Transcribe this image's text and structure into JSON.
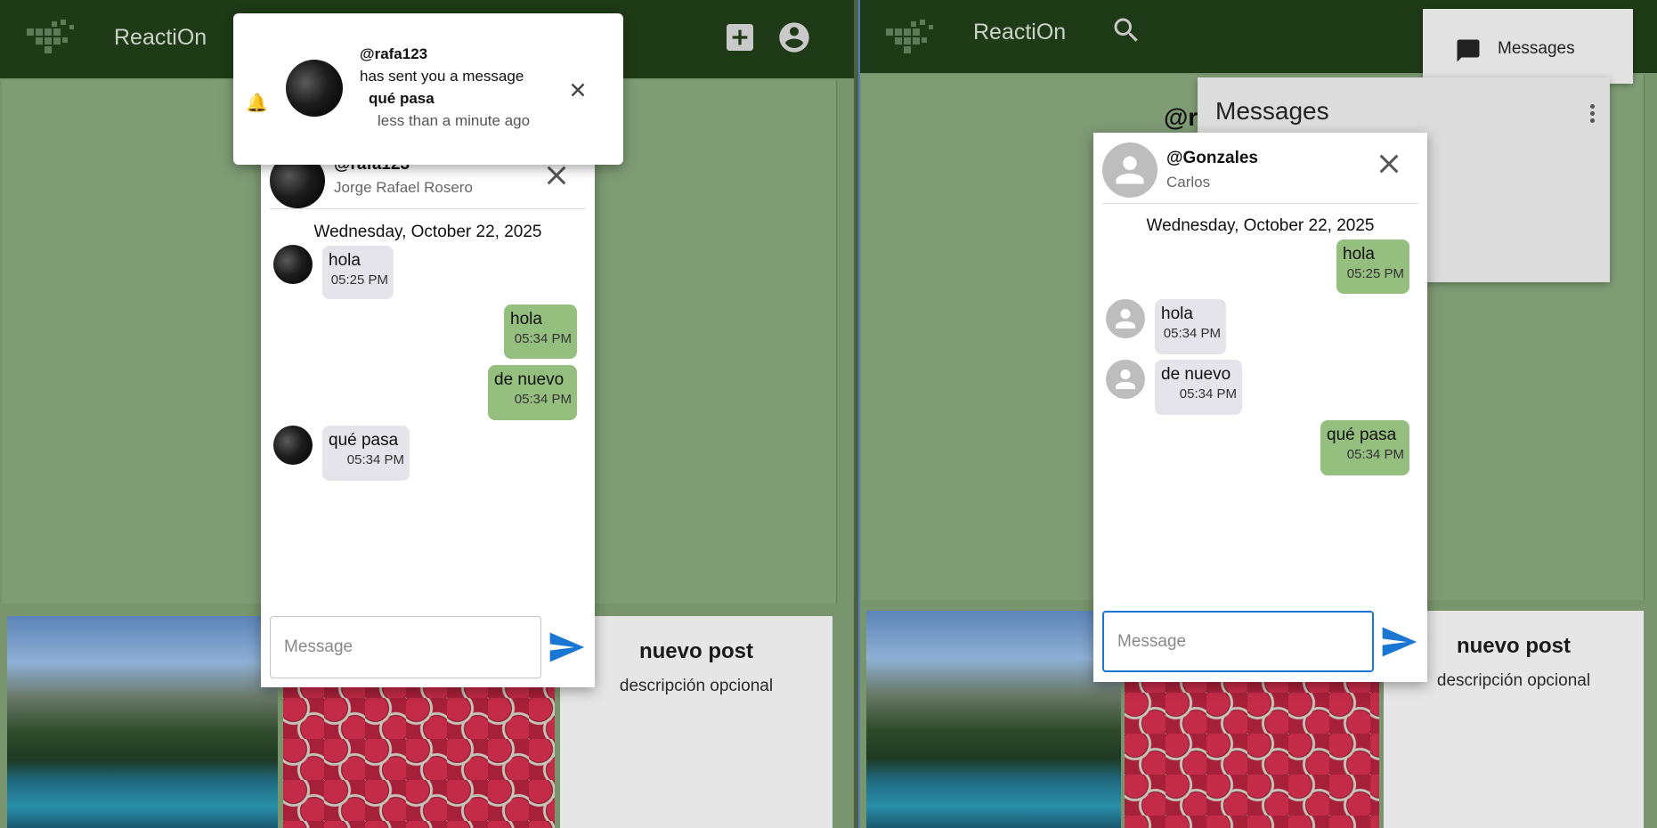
{
  "app": {
    "title": "ReactiOn"
  },
  "left": {
    "toast": {
      "handle": "@rafa123",
      "line2": "has sent you a message",
      "message": "qué pasa",
      "time": "less than a minute ago"
    },
    "chat": {
      "handle": "@rafa123",
      "name": "Jorge Rafael Rosero",
      "date": "Wednesday, October 22, 2025",
      "messages": [
        {
          "text": "hola",
          "time": "05:25 PM",
          "dir": "in"
        },
        {
          "text": "hola",
          "time": "05:34 PM",
          "dir": "out"
        },
        {
          "text": "de nuevo",
          "time": "05:34 PM",
          "dir": "out"
        },
        {
          "text": "qué pasa",
          "time": "05:34 PM",
          "dir": "in"
        }
      ],
      "input_placeholder": "Message"
    },
    "post": {
      "title": "nuevo post",
      "desc": "descripción opcional"
    }
  },
  "right": {
    "menu_label": "Messages",
    "panel_title": "Messages",
    "behind_handle": "@r",
    "chat": {
      "handle": "@Gonzales",
      "name": "Carlos",
      "date": "Wednesday, October 22, 2025",
      "messages": [
        {
          "text": "hola",
          "time": "05:25 PM",
          "dir": "out"
        },
        {
          "text": "hola",
          "time": "05:34 PM",
          "dir": "in"
        },
        {
          "text": "de nuevo",
          "time": "05:34 PM",
          "dir": "in"
        },
        {
          "text": "qué pasa",
          "time": "05:34 PM",
          "dir": "out"
        }
      ],
      "input_placeholder": "Message"
    },
    "post": {
      "title": "nuevo post",
      "desc": "descripción opcional"
    }
  },
  "colors": {
    "appbar": "#1f3a17",
    "bubble_out": "#95bf7e",
    "bubble_in": "#e4e4ea",
    "send": "#1976d2"
  },
  "icons": [
    "logo-icon",
    "add-box-icon",
    "account-circle-icon",
    "search-icon",
    "chat-icon",
    "close-icon",
    "send-icon",
    "bell-icon",
    "more-vert-icon",
    "person-icon"
  ]
}
